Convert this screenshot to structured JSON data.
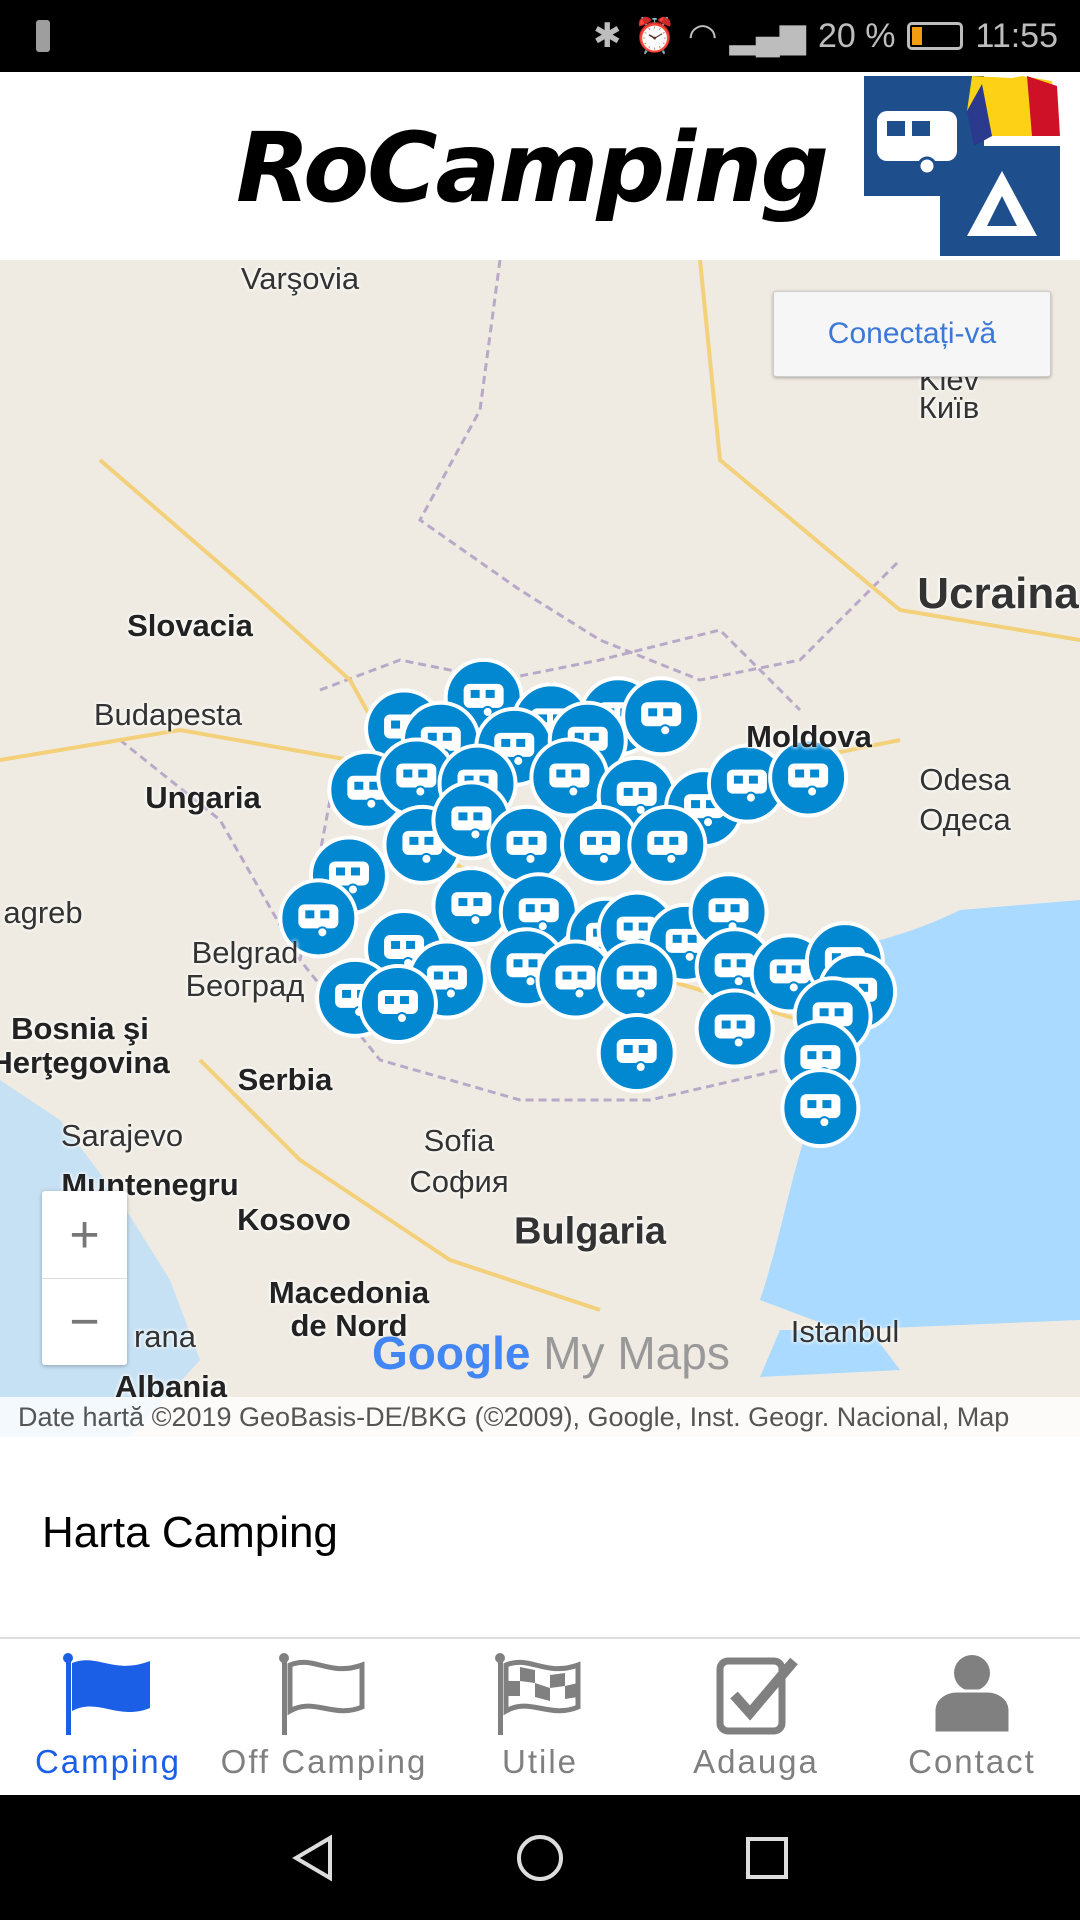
{
  "status_bar": {
    "battery": "20 %",
    "time": "11:55"
  },
  "header": {
    "app_name": "RoCamping"
  },
  "map": {
    "login_button": "Conectați-vă",
    "zoom_in": "+",
    "zoom_out": "−",
    "logo_google": "Google",
    "logo_mymaps": "My Maps",
    "attribution": "Date hartă ©2019 GeoBasis-DE/BKG (©2009), Google, Inst. Geogr. Nacional, Map",
    "labels": [
      "Varşovia",
      "Kiev",
      "Київ",
      "Ucraina",
      "Slovacia",
      "Budapesta",
      "Ungaria",
      "Moldova",
      "Odesa",
      "Одеса",
      "agreb",
      "Belgrad",
      "Београд",
      "Bosnia şi",
      "Herţegovina",
      "Serbia",
      "Sarajevo",
      "Sofia",
      "София",
      "Muntenegru",
      "Kosovo",
      "Bulgaria",
      "Macedonia",
      "de Nord",
      "Istanbul",
      "rana",
      "Albania"
    ],
    "marker_color": "#0288d1",
    "marker_icon": "caravan-icon"
  },
  "section_title": "Harta Camping",
  "tabs": [
    {
      "label": "Camping",
      "icon": "flag-filled-icon",
      "active": true
    },
    {
      "label": "Off Camping",
      "icon": "flag-outline-icon"
    },
    {
      "label": "Utile",
      "icon": "checkered-flag-icon"
    },
    {
      "label": "Adauga",
      "icon": "checkbox-icon"
    },
    {
      "label": "Contact",
      "icon": "user-icon"
    }
  ],
  "colors": {
    "active_tab": "#1a5fe6",
    "inactive_tab": "#808080"
  }
}
